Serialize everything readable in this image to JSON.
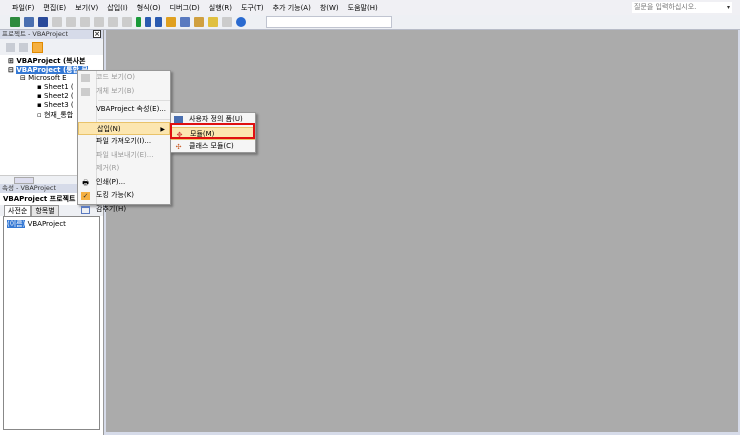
{
  "menubar": {
    "items": [
      "파일(F)",
      "편집(E)",
      "보기(V)",
      "삽입(I)",
      "형식(O)",
      "디버그(D)",
      "실행(R)",
      "도구(T)",
      "추가 기능(A)",
      "창(W)",
      "도움말(H)"
    ],
    "ask_placeholder": "질문을 입력하십시오."
  },
  "project_panel": {
    "title": "프로젝트 - VBAProject",
    "tree": [
      "VBAProject (복사본",
      "VBAProject (통합 문",
      "Microsoft E",
      "Sheet1 (",
      "Sheet2 (",
      "Sheet3 (",
      "현재_통합"
    ]
  },
  "properties_panel": {
    "title": "속성 - VBAProject",
    "header": "VBAProject 프로젝트",
    "tabs": [
      "사전순",
      "항목별"
    ],
    "row_name": "(이름)",
    "row_value": "VBAProject"
  },
  "context_menu": {
    "items": [
      "코드 보기(O)",
      "개체 보기(B)",
      "VBAProject 속성(E)...",
      "삽입(N)",
      "파일 가져오기(I)...",
      "파일 내보내기(E)...",
      "제거(R)",
      "인쇄(P)...",
      "도킹 가능(K)",
      "감추기(H)"
    ]
  },
  "submenu": {
    "items": [
      "사용자 정의 폼(U)",
      "모듈(M)",
      "클래스 모듈(C)"
    ]
  }
}
